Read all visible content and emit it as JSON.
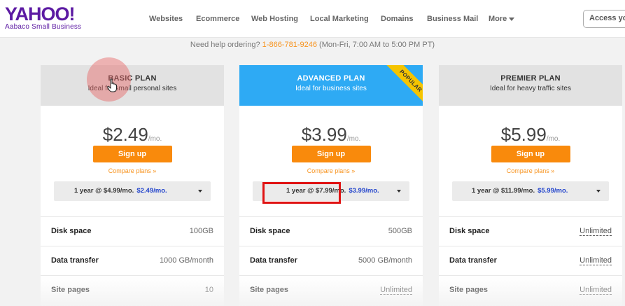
{
  "logo": {
    "word": "YAHOO!",
    "sub": "Aabaco Small Business"
  },
  "nav": {
    "items": [
      "Websites",
      "Ecommerce",
      "Web Hosting",
      "Local Marketing",
      "Domains",
      "Business Mail",
      "More"
    ],
    "access_button": "Access you"
  },
  "help": {
    "prefix": "Need help ordering? ",
    "phone": "1-866-781-9246",
    "hours": " (Mon-Fri, 7:00 AM to 5:00 PM PT)"
  },
  "plans": [
    {
      "name": "BASIC PLAN",
      "subtitle": "Ideal for small personal sites",
      "price": "$2.49",
      "per": "/mo.",
      "signup": "Sign up",
      "compare": "Compare plans »",
      "term_prefix": "1 year @",
      "term_orig": "$4.99/mo.",
      "term_sale": "$2.49/mo.",
      "features": [
        {
          "label": "Disk space",
          "value": "100GB"
        },
        {
          "label": "Data transfer",
          "value": "1000 GB/month"
        },
        {
          "label": "Site pages",
          "value": "10"
        }
      ]
    },
    {
      "name": "ADVANCED PLAN",
      "subtitle": "Ideal for business sites",
      "badge": "POPULAR",
      "price": "$3.99",
      "per": "/mo.",
      "signup": "Sign up",
      "compare": "Compare plans »",
      "term_prefix": "1 year @",
      "term_orig": "$7.99/mo.",
      "term_sale": "$3.99/mo.",
      "features": [
        {
          "label": "Disk space",
          "value": "500GB"
        },
        {
          "label": "Data transfer",
          "value": "5000 GB/month"
        },
        {
          "label": "Site pages",
          "value": "Unlimited"
        }
      ]
    },
    {
      "name": "PREMIER PLAN",
      "subtitle": "Ideal for heavy traffic sites",
      "price": "$5.99",
      "per": "/mo.",
      "signup": "Sign up",
      "compare": "Compare plans »",
      "term_prefix": "1 year @",
      "term_orig": "$11.99/mo.",
      "term_sale": "$5.99/mo.",
      "features": [
        {
          "label": "Disk space",
          "value": "Unlimited"
        },
        {
          "label": "Data transfer",
          "value": "Unlimited"
        },
        {
          "label": "Site pages",
          "value": "Unlimited"
        }
      ]
    }
  ],
  "colors": {
    "brand": "#5c1aa3",
    "accent": "#f98a0c",
    "advanced_header": "#2eaaf4",
    "sale_price": "#2244cc",
    "badge": "#f5c400",
    "highlight_box": "#e01313"
  },
  "icons": {
    "menu_caret": "chevron-down-icon",
    "dropdown_caret": "chevron-down-icon",
    "pointer": "hand-cursor-icon"
  }
}
